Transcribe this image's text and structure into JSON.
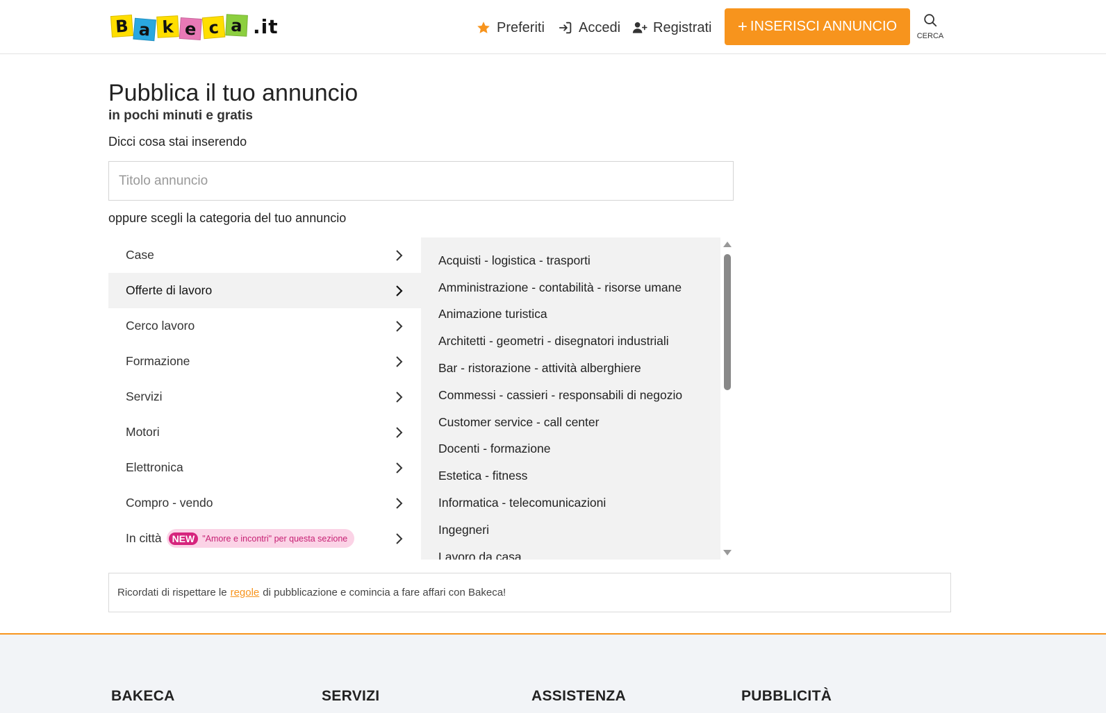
{
  "header": {
    "logo_letters": [
      "B",
      "a",
      "k",
      "e",
      "c",
      "a"
    ],
    "logo_suffix": ".it",
    "nav": {
      "preferiti": "Preferiti",
      "accedi": "Accedi",
      "registrati": "Registrati"
    },
    "insert_button": "INSERISCI ANNUNCIO",
    "search_label": "CERCA",
    "accent_color": "#f7941d"
  },
  "main": {
    "title": "Pubblica il tuo annuncio",
    "subtitle": "in pochi minuti e gratis",
    "prompt": "Dicci cosa stai inserendo",
    "title_input": {
      "value": "",
      "placeholder": "Titolo annuncio"
    },
    "category_prompt": "oppure scegli la categoria del tuo annuncio",
    "categories": [
      {
        "label": "Case"
      },
      {
        "label": "Offerte di lavoro",
        "selected": true
      },
      {
        "label": "Cerco lavoro"
      },
      {
        "label": "Formazione"
      },
      {
        "label": "Servizi"
      },
      {
        "label": "Motori"
      },
      {
        "label": "Elettronica"
      },
      {
        "label": "Compro - vendo"
      },
      {
        "label": "In città",
        "badge": "NEW",
        "badge_text": "\"Amore e incontri\" per questa sezione"
      }
    ],
    "subcategories": [
      "Acquisti - logistica - trasporti",
      "Amministrazione - contabilità - risorse umane",
      "Animazione turistica",
      "Architetti - geometri - disegnatori industriali",
      "Bar - ristorazione - attività alberghiere",
      "Commessi - cassieri - responsabili di negozio",
      "Customer service - call center",
      "Docenti - formazione",
      "Estetica - fitness",
      "Informatica - telecomunicazioni",
      "Ingegneri",
      "Lavoro da casa"
    ],
    "notice": {
      "before": "Ricordati di rispettare le",
      "link": "regole",
      "after": "di pubblicazione e comincia a fare affari con Bakeca!"
    }
  },
  "footer": {
    "columns": [
      "BAKECA",
      "SERVIZI",
      "ASSISTENZA",
      "PUBBLICITÀ"
    ]
  }
}
